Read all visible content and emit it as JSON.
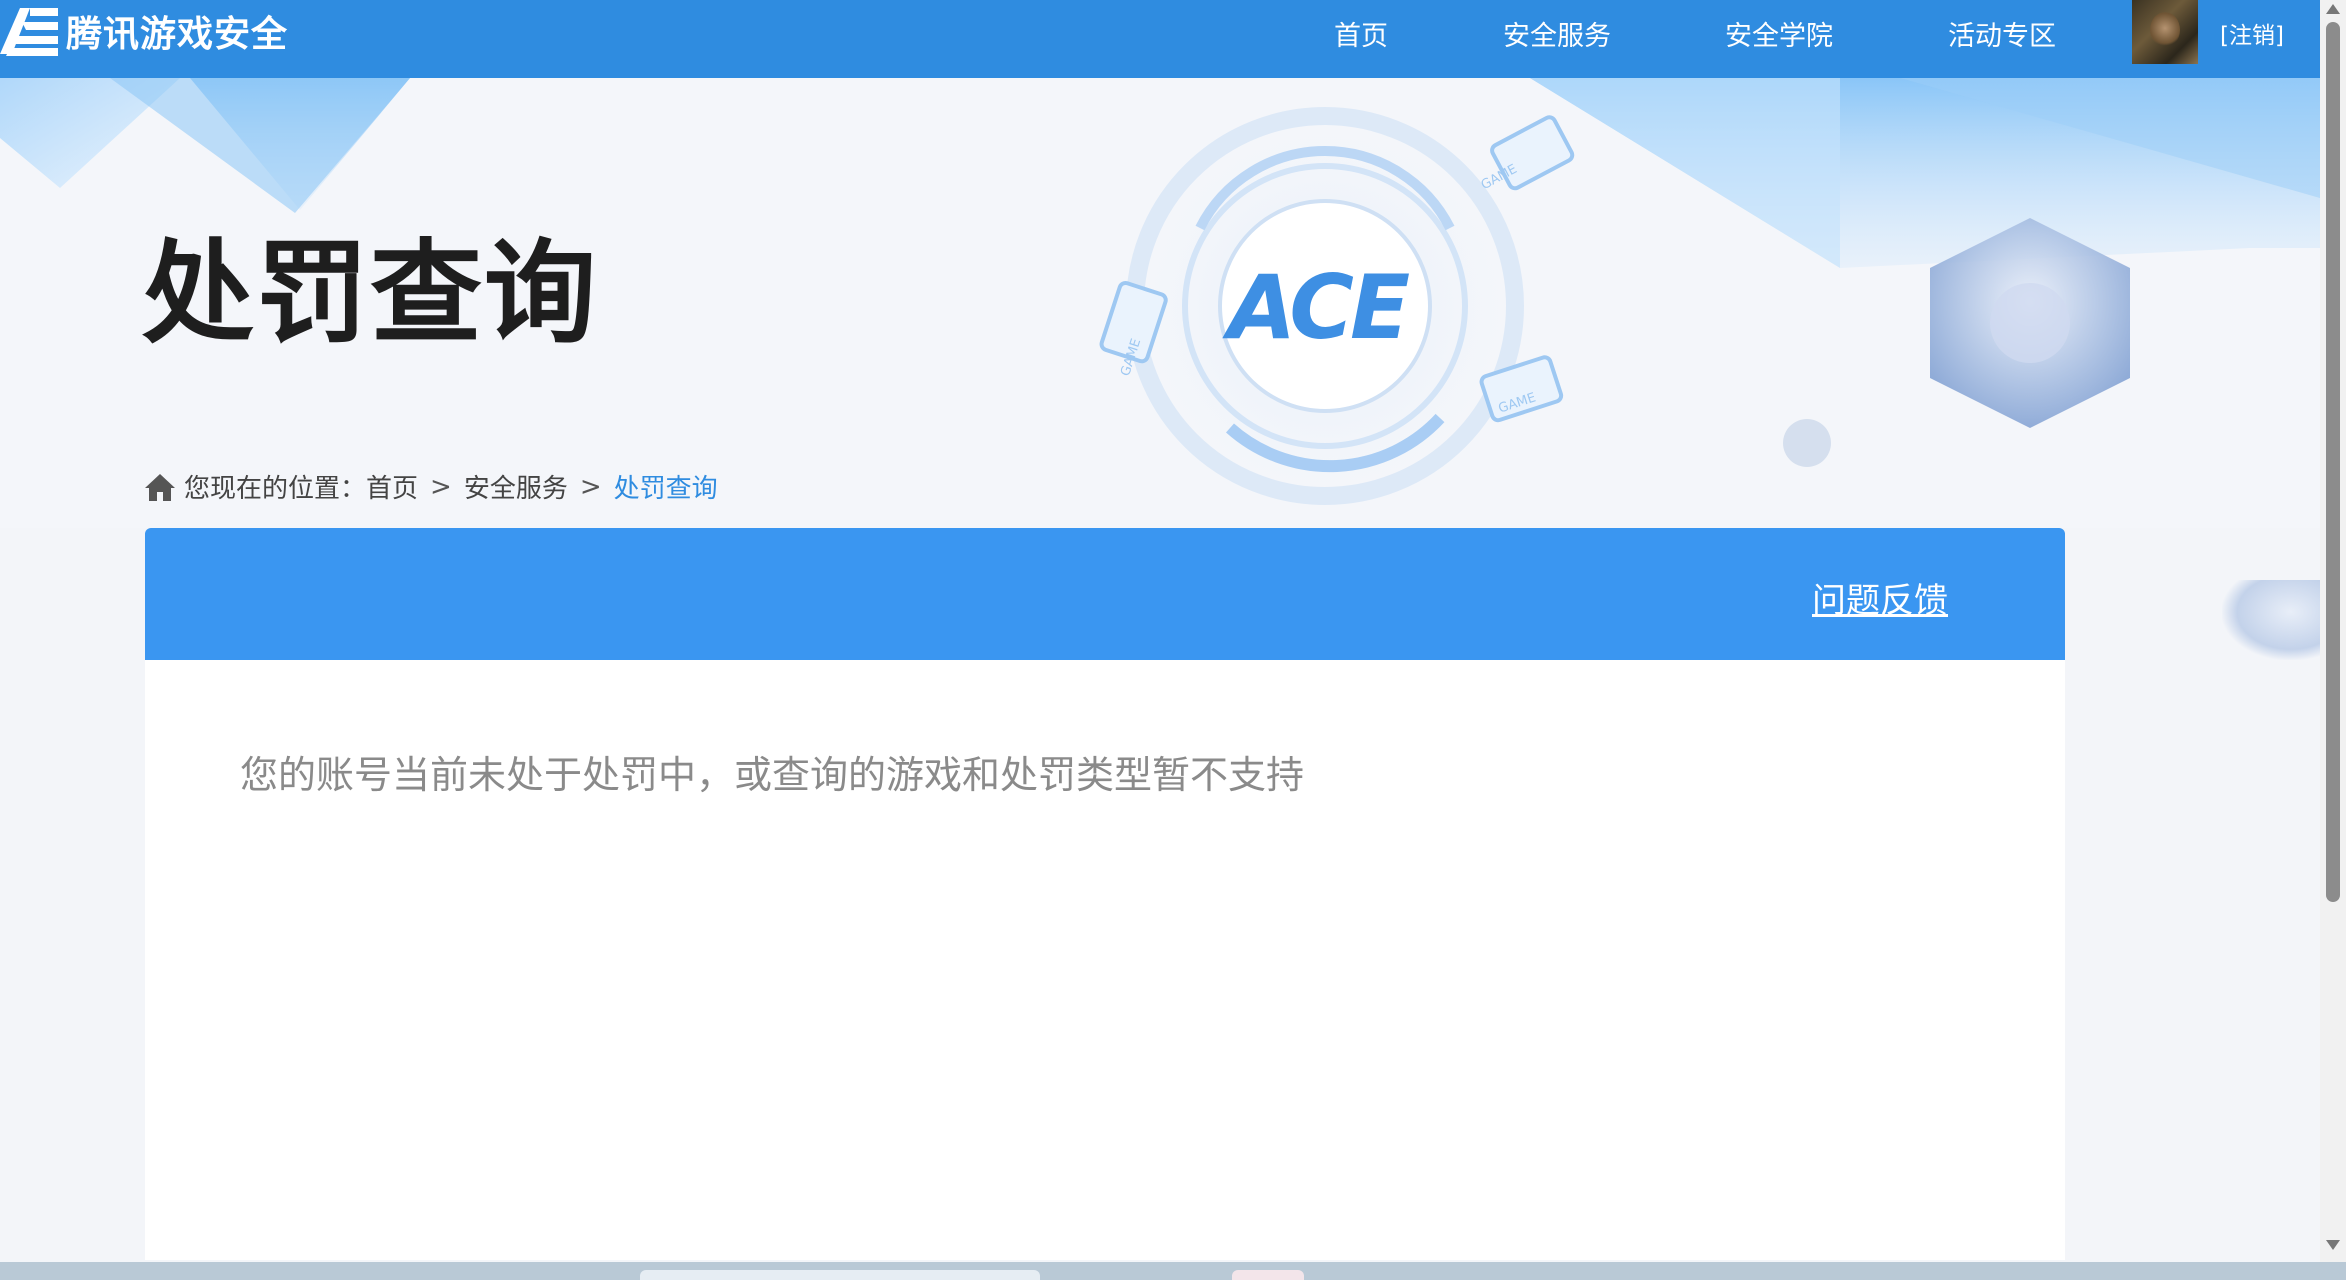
{
  "header": {
    "logo_text": "腾讯游戏安全",
    "nav": [
      {
        "label": "首页"
      },
      {
        "label": "安全服务"
      },
      {
        "label": "安全学院"
      },
      {
        "label": "活动专区"
      }
    ],
    "logout_label": "[注销]"
  },
  "hero": {
    "title": "处罚查询",
    "emblem_text": "ACE",
    "badge_text": "GAME"
  },
  "breadcrumb": {
    "prefix": "您现在的位置：",
    "items": [
      "首页",
      "安全服务"
    ],
    "separator": ">",
    "current": "处罚查询"
  },
  "panel": {
    "feedback_label": "问题反馈",
    "message": "您的账号当前未处于处罚中，或查询的游戏和处罚类型暂不支持"
  },
  "colors": {
    "nav_bg": "#2f8ce0",
    "panel_header": "#3a96f1",
    "accent_link": "#2f8ce0",
    "title": "#1e1e1e",
    "message": "#8a8a8a"
  }
}
